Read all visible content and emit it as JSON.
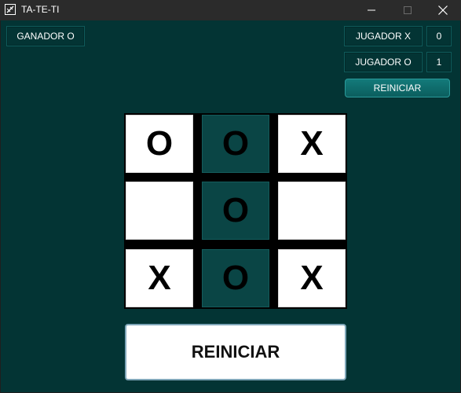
{
  "window": {
    "title": "TA-TE-TI"
  },
  "status": {
    "winner_text": "GANADOR O"
  },
  "score": {
    "x_label": "JUGADOR X",
    "x_value": "0",
    "o_label": "JUGADOR O",
    "o_value": "1"
  },
  "controls": {
    "small_reset_label": "REINICIAR",
    "big_reset_label": "REINICIAR"
  },
  "board": {
    "cells": [
      "O",
      "O",
      "X",
      "",
      "O",
      "",
      "X",
      "O",
      "X"
    ],
    "winning_cells": [
      1,
      4,
      7
    ]
  },
  "colors": {
    "background": "#033434",
    "highlight_cell": "#0a4545",
    "accent_button": "#0b6b6b"
  },
  "icons": {
    "app": "tic-tac-toe-icon",
    "minimize": "minimize-icon",
    "maximize": "maximize-icon",
    "close": "close-icon"
  }
}
